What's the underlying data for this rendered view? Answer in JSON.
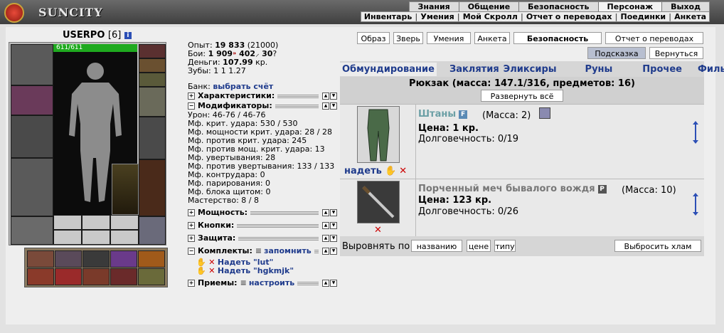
{
  "logo": {
    "text": "SUNCITY"
  },
  "top_menu": [
    "Знания",
    "Общение",
    "Безопасность",
    "Персонаж",
    "Выход"
  ],
  "sub_menu": [
    "Инвентарь",
    "Умения",
    "Мой Скролл",
    "Отчет о переводах",
    "Поединки",
    "Анкета"
  ],
  "character": {
    "name": "USERPO",
    "level": "[6]",
    "hp": "611/611"
  },
  "stats": {
    "exp_label": "Опыт:",
    "exp_value": "19 833",
    "exp_next": "(21000)",
    "fights_label": "Бои:",
    "fights_wins": "1 909",
    "fights_losses": "402",
    "fights_draws": "30",
    "money_label": "Деньги:",
    "money_value": "107.99",
    "money_unit": "кр.",
    "teeth_label": "Зубы:",
    "teeth_values": "1 1 1.27",
    "bank_label": "Банк:",
    "bank_link": "выбрать счёт"
  },
  "sections": {
    "chars": "Характеристики:",
    "mods": "Модификаторы:",
    "power": "Мощность:",
    "buttons": "Кнопки:",
    "defense": "Защита:",
    "sets": "Комплекты:",
    "sets_link": "запомнить",
    "techniques": "Приемы:",
    "tech_link": "настроить"
  },
  "modifiers": [
    "Урон: 46-76 / 46-76",
    "Мф. крит. удара: 530 / 530",
    "Мф. мощности крит. удара: 28 / 28",
    "Мф. против крит. удара: 245",
    "Мф. против мощ. крит. удара: 13",
    "Мф. увертывания: 28",
    "Мф. против увертывания: 133 / 133",
    "Мф. контрудара: 0",
    "Мф. парирования: 0",
    "Мф. блока щитом: 0",
    "Мастерство: 8 / 8"
  ],
  "sets": [
    "Надеть \"lut\"",
    "Надеть \"hgkmjk\""
  ],
  "top_buttons": [
    "Образ",
    "Зверь",
    "Умения",
    "Анкета",
    "Безопасность",
    "Отчет о переводах"
  ],
  "hint_button": "Подсказка",
  "back_button": "Вернуться",
  "tabs": [
    "Обмундирование",
    "Заклятия",
    "Эликсиры",
    "Руны",
    "Прочее",
    "Фильтр"
  ],
  "backpack": {
    "title": "Рюкзак (масса: 147.1/316, предметов: 16)",
    "expand_button": "Развернуть всё"
  },
  "items": [
    {
      "name": "Штаны",
      "badge": "F",
      "mass": "(Масса: 2)",
      "price": "Цена: 1 кр.",
      "durability": "Долговечность: 0/19",
      "action": "надеть"
    },
    {
      "name": "Порченный меч бывалого вождя",
      "badge": "P",
      "mass": "(Масса: 10)",
      "price": "Цена: 123 кр.",
      "durability": "Долговечность: 0/26"
    }
  ],
  "footer": {
    "sort_label": "Выровнять по",
    "sort_name": "названию",
    "sort_price": "цене",
    "sort_type": "типу",
    "junk_button": "Выбросить хлам"
  }
}
